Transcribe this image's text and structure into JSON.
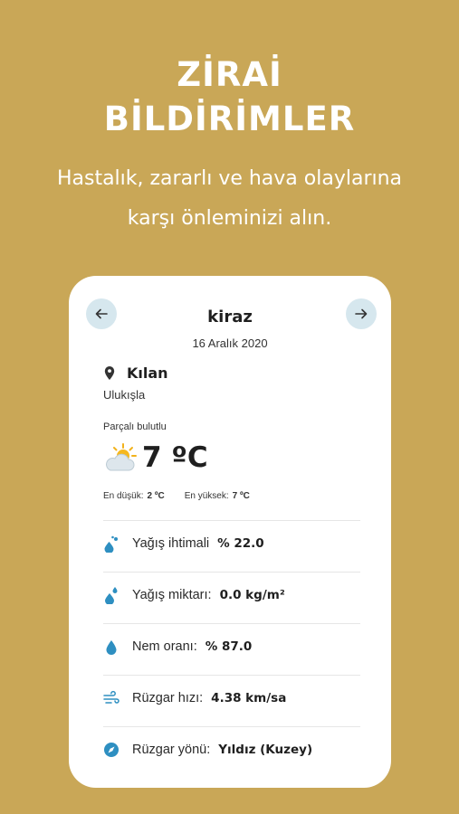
{
  "promo": {
    "title_line1": "ZİRAİ",
    "title_line2": "BİLDİRİMLER",
    "subtitle_line1": "Hastalık, zararlı ve hava olaylarına",
    "subtitle_line2": "karşı önleminizi alın."
  },
  "card": {
    "crop": "kiraz",
    "date": "16 Aralık 2020",
    "location": "Kılan",
    "district": "Ulukışla",
    "condition": "Parçalı bulutlu",
    "temperature": "7 ºC",
    "min_label": "En düşük:",
    "min_value": "2 ºC",
    "max_label": "En yüksek:",
    "max_value": "7 ºC",
    "metrics": [
      {
        "icon": "rain-chance-icon",
        "label": "Yağış ihtimali",
        "value": "% 22.0"
      },
      {
        "icon": "rain-amount-icon",
        "label": "Yağış miktarı:",
        "value": "0.0 kg/m²"
      },
      {
        "icon": "humidity-icon",
        "label": "Nem oranı:",
        "value": "% 87.0"
      },
      {
        "icon": "wind-icon",
        "label": "Rüzgar hızı:",
        "value": "4.38 km/sa"
      },
      {
        "icon": "compass-icon",
        "label": "Rüzgar yönü:",
        "value": "Yıldız (Kuzey)"
      }
    ]
  },
  "colors": {
    "background": "#C9A757",
    "nav_button": "#D6E7EE",
    "icon_blue": "#2E8FC1"
  }
}
